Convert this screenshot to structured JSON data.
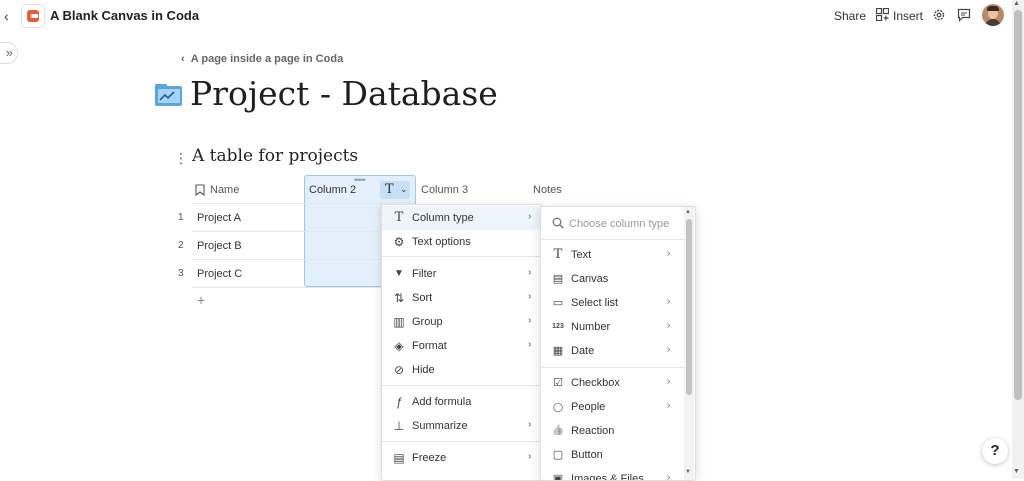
{
  "header": {
    "doc_title": "A Blank Canvas in Coda",
    "share_label": "Share",
    "insert_label": "Insert"
  },
  "breadcrumb": "A page inside a page in Coda",
  "page_title": "Project - Database",
  "table": {
    "title": "A table for projects",
    "columns": [
      "Name",
      "Column 2",
      "Column 3",
      "Notes"
    ],
    "rows": [
      {
        "num": "1",
        "name": "Project A"
      },
      {
        "num": "2",
        "name": "Project B"
      },
      {
        "num": "3",
        "name": "Project C"
      }
    ],
    "add_row": "+"
  },
  "menu": {
    "items": [
      {
        "icon": "T",
        "icon_name": "text-type-icon",
        "label": "Column type",
        "submenu": true
      },
      {
        "icon": "⚙",
        "icon_name": "gear-icon",
        "label": "Text options",
        "submenu": false
      },
      {
        "icon": "▼",
        "icon_name": "filter-icon",
        "label": "Filter",
        "submenu": true
      },
      {
        "icon": "⇅",
        "icon_name": "sort-icon",
        "label": "Sort",
        "submenu": true
      },
      {
        "icon": "▥",
        "icon_name": "group-icon",
        "label": "Group",
        "submenu": true
      },
      {
        "icon": "◈",
        "icon_name": "paint-bucket-icon",
        "label": "Format",
        "submenu": true
      },
      {
        "icon": "⊘",
        "icon_name": "hide-eye-icon",
        "label": "Hide",
        "submenu": false
      },
      {
        "icon": "ƒ",
        "icon_name": "formula-icon",
        "label": "Add formula",
        "submenu": false
      },
      {
        "icon": "⊥",
        "icon_name": "summarize-icon",
        "label": "Summarize",
        "submenu": true
      },
      {
        "icon": "▤",
        "icon_name": "freeze-icon",
        "label": "Freeze",
        "submenu": true
      }
    ]
  },
  "submenu": {
    "search_placeholder": "Choose column type",
    "items": [
      {
        "icon": "T",
        "icon_name": "text-icon",
        "label": "Text",
        "submenu": true
      },
      {
        "icon": "▤",
        "icon_name": "canvas-icon",
        "label": "Canvas",
        "submenu": false
      },
      {
        "icon": "▭",
        "icon_name": "select-list-icon",
        "label": "Select list",
        "submenu": true
      },
      {
        "icon": "123",
        "icon_name": "number-icon",
        "label": "Number",
        "submenu": true
      },
      {
        "icon": "▦",
        "icon_name": "calendar-icon",
        "label": "Date",
        "submenu": true
      },
      {
        "icon": "☑",
        "icon_name": "checkbox-icon",
        "label": "Checkbox",
        "submenu": true
      },
      {
        "icon": "◯",
        "icon_name": "person-icon",
        "label": "People",
        "submenu": true
      },
      {
        "icon": "👍",
        "icon_name": "thumbs-up-icon",
        "label": "Reaction",
        "submenu": false
      },
      {
        "icon": "▢",
        "icon_name": "button-icon",
        "label": "Button",
        "submenu": false
      },
      {
        "icon": "▣",
        "icon_name": "image-icon",
        "label": "Images & Files",
        "submenu": true
      }
    ]
  },
  "help_label": "?"
}
